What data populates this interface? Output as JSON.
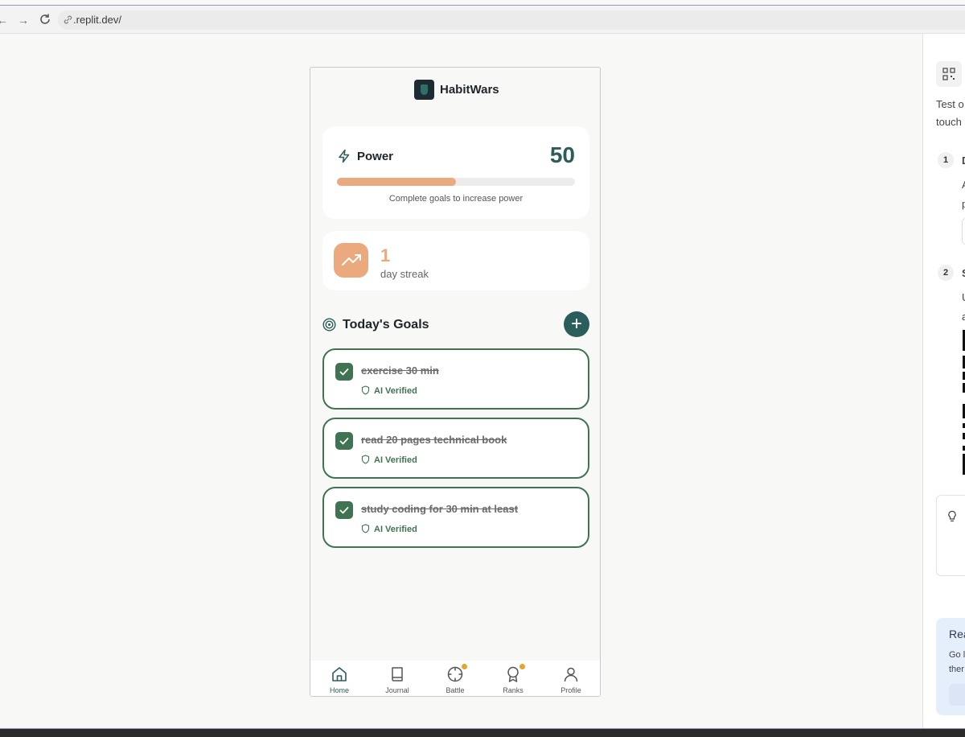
{
  "browser": {
    "url": ".replit.dev/",
    "back_icon": "back-arrow-icon",
    "forward_icon": "forward-arrow-icon",
    "reload_icon": "reload-icon"
  },
  "app": {
    "title": "HabitWars",
    "power": {
      "label": "Power",
      "value": "50",
      "progress_fraction": 0.5,
      "hint": "Complete goals to increase power"
    },
    "streak": {
      "count": "1",
      "label": "day streak"
    },
    "goals": {
      "title": "Today's Goals",
      "add_label": "+",
      "items": [
        {
          "text": "exercise 30 min",
          "status": "AI Verified",
          "done": true
        },
        {
          "text": "read 20 pages technical book",
          "status": "AI Verified",
          "done": true
        },
        {
          "text": "study coding for 30 min at least",
          "status": "AI Verified",
          "done": true
        }
      ]
    },
    "tabs": [
      {
        "label": "Home",
        "icon": "home-icon",
        "active": true,
        "badge": false
      },
      {
        "label": "Journal",
        "icon": "book-icon",
        "active": false,
        "badge": false
      },
      {
        "label": "Battle",
        "icon": "crosshair-icon",
        "active": false,
        "badge": true
      },
      {
        "label": "Ranks",
        "icon": "award-icon",
        "active": false,
        "badge": true
      },
      {
        "label": "Profile",
        "icon": "user-icon",
        "active": false,
        "badge": false
      }
    ]
  },
  "right_panel": {
    "text_line1": "Test o",
    "text_line2": "touch",
    "step1": "1",
    "step1_letter": "D",
    "step1_line1": "A",
    "step1_line2": "p",
    "step2": "2",
    "step2_letter": "S",
    "step2_line1": "U",
    "step2_line2": "a",
    "blue_title": "Rea",
    "blue_line1": "Go l",
    "blue_line2": "ther"
  },
  "colors": {
    "accent_teal": "#2b5d5b",
    "accent_orange": "#eba97e",
    "verified_green": "#3f7351",
    "badge_yellow": "#e0a82e"
  }
}
